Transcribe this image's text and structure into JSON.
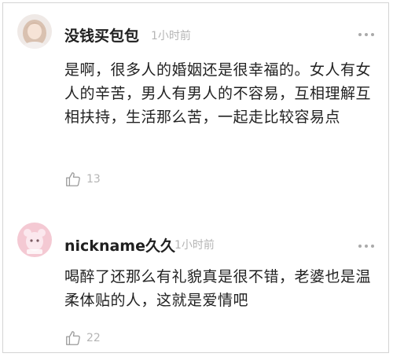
{
  "comments": [
    {
      "username": "没钱买包包",
      "time": "1小时前",
      "text": "是啊，很多人的婚姻还是很幸福的。女人有女人的辛苦，男人有男人的不容易，互相理解互相扶持，生活那么苦，一起走比较容易点",
      "likes": "13",
      "avatar_icon": "avatar-girl-icon"
    },
    {
      "username": "nickname久久",
      "time": "1小时前",
      "text": "喝醉了还那么有礼貌真是很不错，老婆也是温柔体贴的人，这就是爱情吧",
      "likes": "22",
      "avatar_icon": "avatar-pink-icon"
    }
  ],
  "colors": {
    "meta_gray": "#b5b5b5",
    "text_dark": "#222222",
    "pink_avatar": "#f4c9d3"
  },
  "icons": {
    "like": "thumbs-up-icon",
    "more": "more-dots-icon"
  }
}
